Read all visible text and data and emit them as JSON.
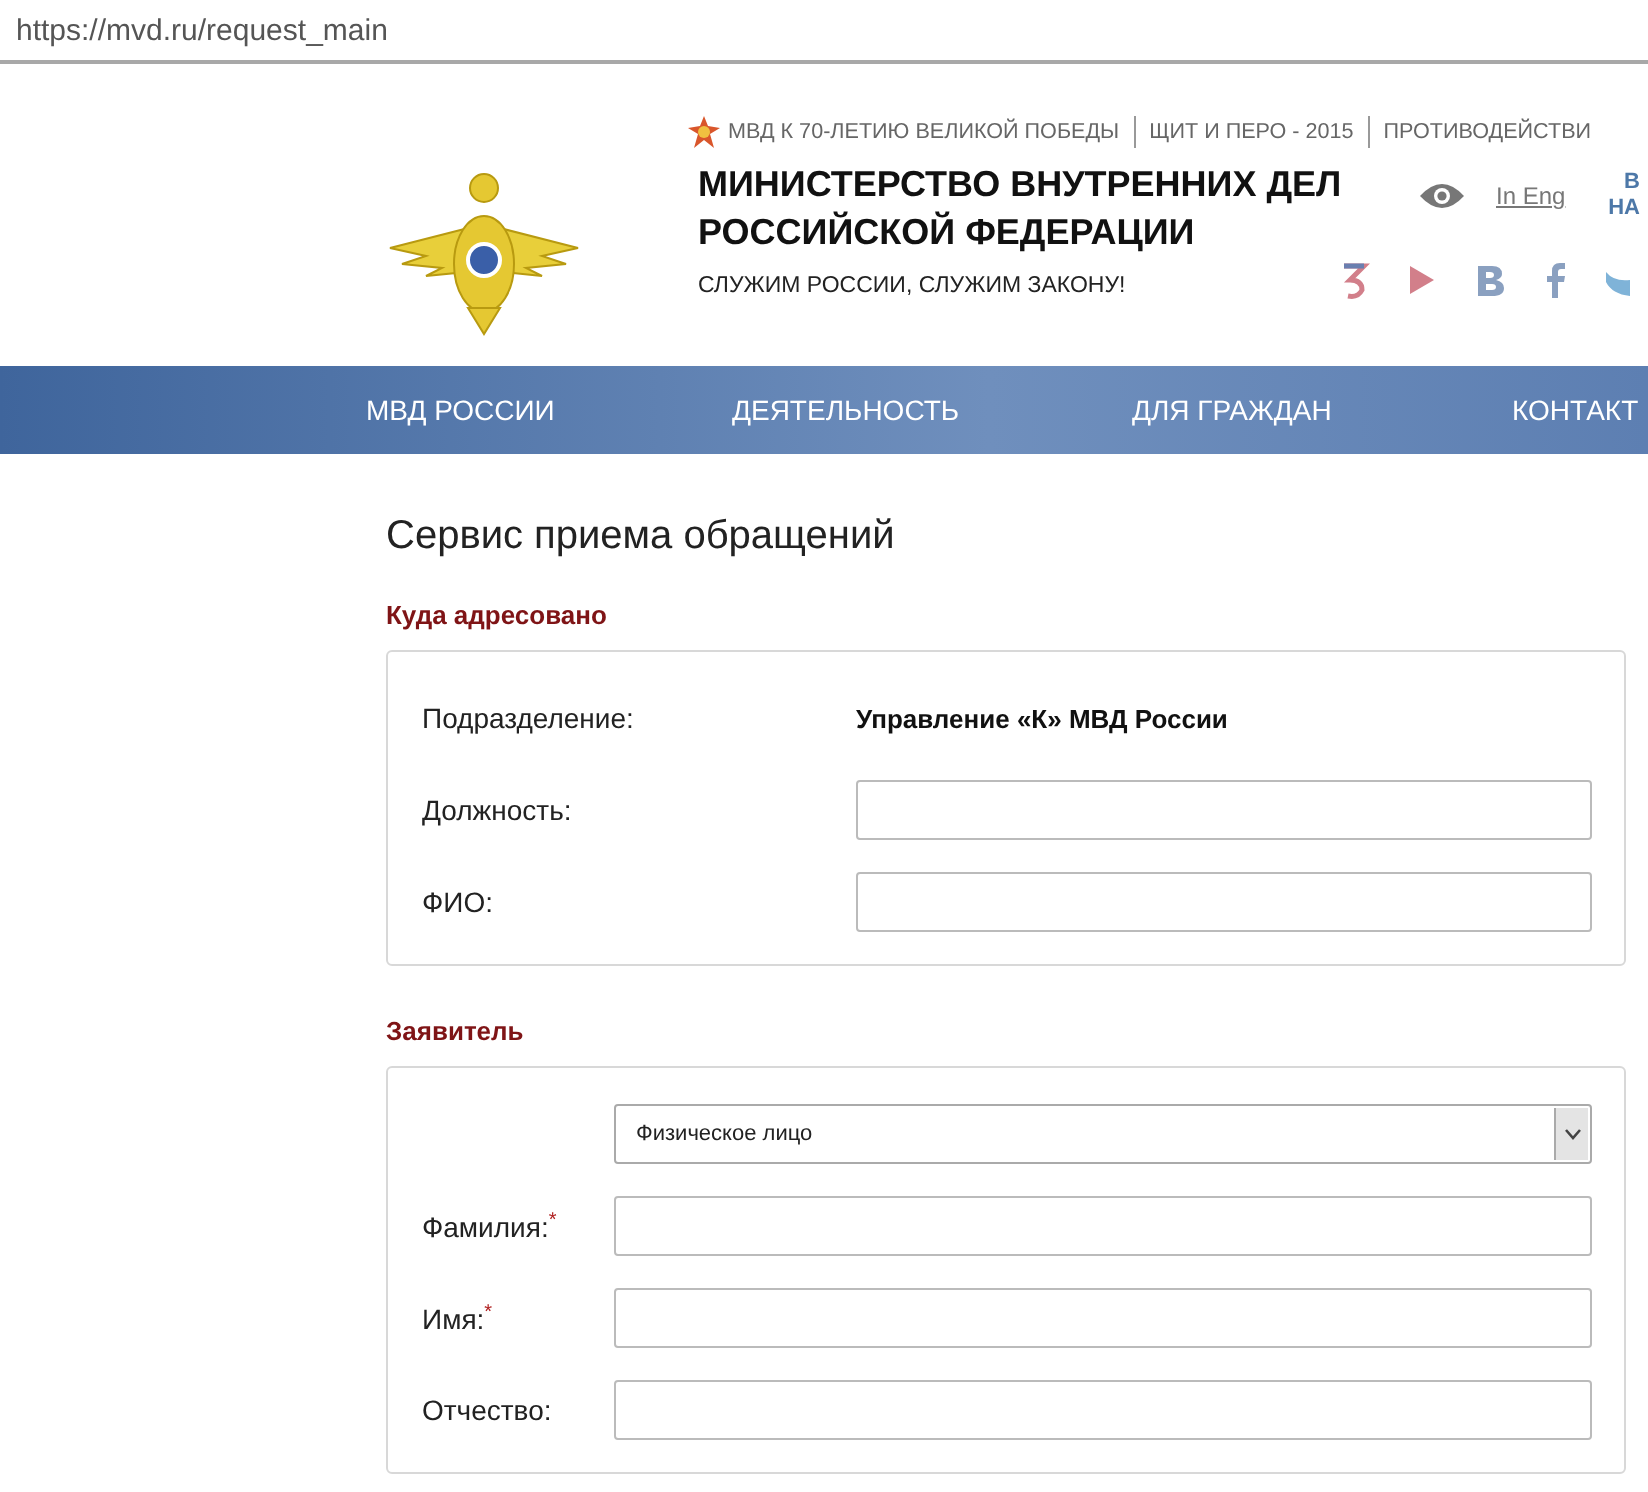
{
  "address_bar": {
    "url": "https://mvd.ru/request_main"
  },
  "header": {
    "top_links": [
      {
        "label": "МВД К 70-ЛЕТИЮ ВЕЛИКОЙ ПОБЕДЫ",
        "kind": "star"
      },
      {
        "label": "ЩИТ И ПЕРО - 2015",
        "kind": "plain"
      },
      {
        "label": "ПРОТИВОДЕЙСТВИ",
        "kind": "plain"
      }
    ],
    "title_lines": [
      "МИНИСТЕРСТВО ВНУТРЕННИХ ДЕЛ",
      "РОССИЙСКОЙ ФЕДЕРАЦИИ"
    ],
    "slogan": "СЛУЖИМ РОССИИ, СЛУЖИМ ЗАКОНУ!",
    "language_link": "In Eng",
    "cut_link_lines": [
      "В",
      "НА"
    ]
  },
  "nav": {
    "items": [
      "МВД РОССИИ",
      "ДЕЯТЕЛЬНОСТЬ",
      "ДЛЯ ГРАЖДАН",
      "КОНТАКТ"
    ]
  },
  "main": {
    "heading": "Сервис приема обращений",
    "sections": [
      {
        "title": "Куда адресовано",
        "fields": [
          {
            "kind": "static",
            "label": "Подразделение:",
            "value": "Управление «К» МВД России"
          },
          {
            "kind": "input",
            "label": "Должность:"
          },
          {
            "kind": "input",
            "label": "ФИО:"
          }
        ]
      },
      {
        "title": "Заявитель",
        "fields": [
          {
            "kind": "select",
            "value": "Физическое лицо"
          },
          {
            "kind": "input",
            "label": "Фамилия:$^{*}$"
          },
          {
            "kind": "input",
            "label": "Имя:$^{*}$"
          },
          {
            "kind": "input",
            "label": "Отчество:"
          }
        ]
      }
    ]
  }
}
